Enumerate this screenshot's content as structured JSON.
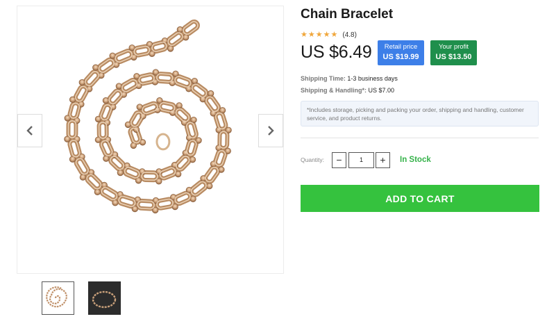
{
  "product": {
    "title": "Chain Bracelet",
    "rating": "(4.8)",
    "stars": 5,
    "price": "US $6.49"
  },
  "retail_box": {
    "label": "Retail price",
    "value": "US $19.99",
    "color": "#3d7fe8"
  },
  "profit_box": {
    "label": "Your profit",
    "value": "US $13.50",
    "color": "#1f8f4c"
  },
  "shipping": {
    "time_label": "Shipping Time:",
    "time_value": "1-3 business days",
    "handling_label": "Shipping & Handling*:",
    "handling_value": "US $7.00"
  },
  "note": "*Includes storage, picking and packing your order, shipping and handling, customer service, and product returns.",
  "quantity": {
    "label": "Quantity:",
    "value": "1",
    "minus": "−",
    "plus": "+"
  },
  "stock_status": "In Stock",
  "cart_button": "ADD TO CART",
  "icons": {
    "prev": "chevron-left-icon",
    "next": "chevron-right-icon",
    "star": "star-icon"
  },
  "colors": {
    "accent_green": "#35c23e",
    "stock_green": "#35b24a",
    "star": "#f0a63a"
  }
}
